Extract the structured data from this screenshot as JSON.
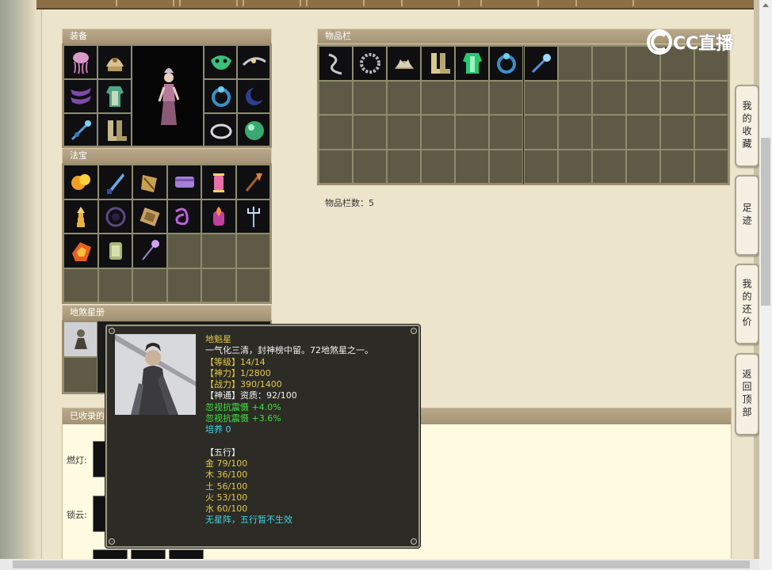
{
  "brand": {
    "logo_text": "CC直播"
  },
  "equipment": {
    "title": "装备",
    "left_icons": [
      "jellyfish-charm",
      "helmet",
      "sash",
      "shirt",
      "scepter",
      "boots"
    ],
    "right_icons": [
      "mask",
      "belt",
      "ring",
      "moon-ring",
      "bracelet",
      "jade-orb"
    ]
  },
  "treasure": {
    "title": "法宝",
    "icons": [
      "fire-cloud",
      "ice-dagger",
      "bell-knife",
      "scroll-tome",
      "lantern",
      "axe-staff",
      "pagoda",
      "vortex",
      "crystal-box",
      "ribbon",
      "flame-lantern",
      "trident",
      "fire-bag",
      "jade-lantern",
      "halberd"
    ]
  },
  "star_book": {
    "title": "地煞星册"
  },
  "inventory": {
    "title": "物品栏",
    "icons": [
      "serpent-whip",
      "bead-necklace",
      "crown-helm",
      "boots",
      "jade-armor",
      "ring",
      "key-scepter"
    ],
    "count_label": "物品栏数：5"
  },
  "side_tabs": [
    {
      "label": "我的收藏"
    },
    {
      "label": "足迹"
    },
    {
      "label": "我的还价"
    },
    {
      "label": "返回顶部"
    }
  ],
  "collected": {
    "title": "已收录的",
    "rows": [
      {
        "label": "燃灯:"
      },
      {
        "label": "锁云:"
      }
    ]
  },
  "tooltip": {
    "name": "地魁星",
    "desc": "一气化三清，封神榜中留。72地煞星之一。",
    "level": "【等级】14/14",
    "spirit": "【神力】1/2800",
    "combat": "【战力】390/1400",
    "power": "【神通】资质：92/100",
    "bonus1": "忽视抗震慑 +4.0%",
    "bonus2": "忽视抗震慑 +3.6%",
    "culture": "培养 0",
    "wuxing_title": "【五行】",
    "metal": "金 79/100",
    "wood": "木 36/100",
    "earth": "土 56/100",
    "fire": "火 53/100",
    "water": "水 60/100",
    "note": "无星阵，五行暂不生效"
  },
  "colors": {
    "gold": "#e3c84a",
    "green": "#3ee33e",
    "cyan": "#3fd6e4",
    "white": "#f2f2f2"
  }
}
